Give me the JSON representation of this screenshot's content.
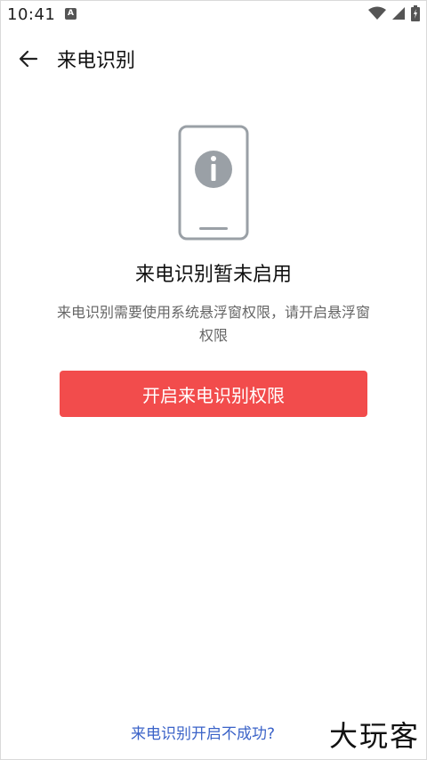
{
  "status_bar": {
    "time": "10:41",
    "notification_icon": "A",
    "icons": [
      "wifi-icon",
      "signal-icon",
      "battery-icon"
    ]
  },
  "header": {
    "back_icon": "arrow-left-icon",
    "title": "来电识别"
  },
  "main": {
    "illustration_icon": "phone-info-icon",
    "heading": "来电识别暂未启用",
    "description": "来电识别需要使用系统悬浮窗权限，请开启悬浮窗权限",
    "primary_button": "开启来电识别权限"
  },
  "footer": {
    "help_link": "来电识别开启不成功?",
    "watermark": "大玩客"
  },
  "colors": {
    "accent": "#f24c4c",
    "link": "#3b63c8",
    "icon_gray": "#9aa0a6"
  }
}
